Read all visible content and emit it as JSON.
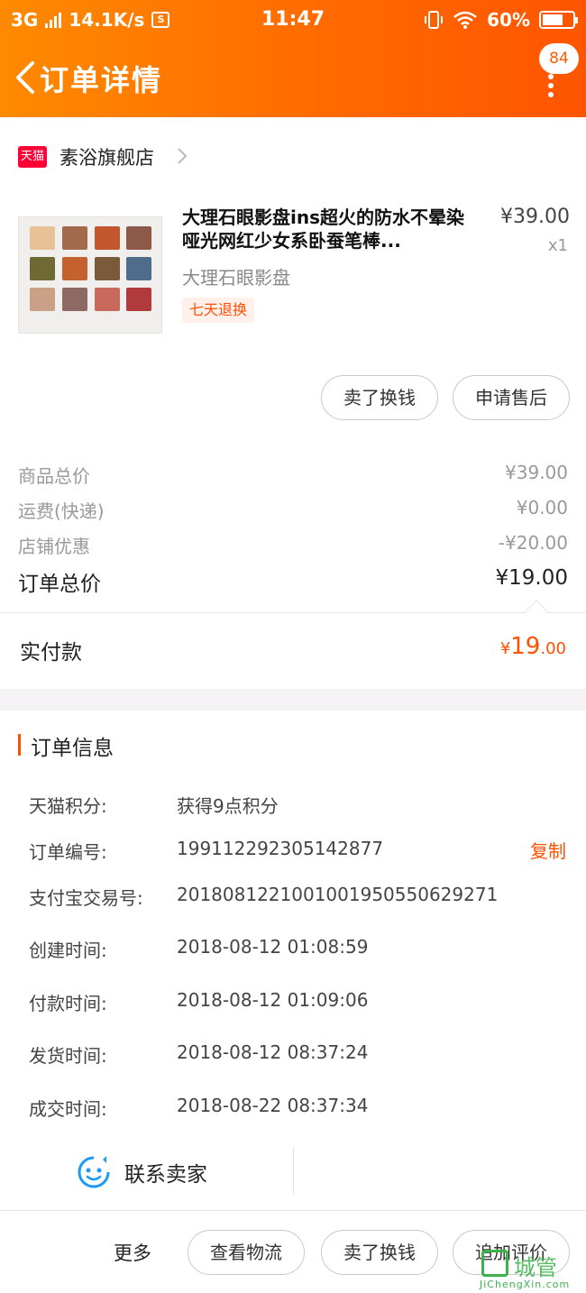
{
  "status_bar": {
    "network": "3G",
    "speed": "14.1K/s",
    "time": "11:47",
    "battery": "60%"
  },
  "header": {
    "title": "订单详情",
    "badge_count": "84"
  },
  "shop": {
    "logo_text": "天猫",
    "name": "素浴旗舰店"
  },
  "product": {
    "title": "大理石眼影盘ins超火的防水不晕染哑光网红少女系卧蚕笔棒...",
    "sku": "大理石眼影盘",
    "price": "¥39.00",
    "quantity": "x1",
    "return_tag": "七天退换",
    "palette_colors": [
      "#e9c196",
      "#a46a4c",
      "#c2572e",
      "#8d5a4a",
      "#6f6a34",
      "#c3622f",
      "#7a5a3a",
      "#4f6d8a",
      "#caa086",
      "#8c6a63",
      "#c8695c",
      "#b03a3c"
    ],
    "buttons": [
      "卖了换钱",
      "申请售后"
    ]
  },
  "summary": {
    "rows": [
      {
        "label": "商品总价",
        "value": "¥39.00"
      },
      {
        "label": "运费(快递)",
        "value": "¥0.00"
      },
      {
        "label": "店铺优惠",
        "value": "-¥20.00"
      }
    ],
    "total_label": "订单总价",
    "total_value": "¥19.00",
    "paid_label": "实付款",
    "paid_currency": "¥",
    "paid_int": "19",
    "paid_dec": ".00"
  },
  "order_info": {
    "section_title": "订单信息",
    "rows": [
      {
        "label": "天猫积分:",
        "value": "获得9点积分"
      },
      {
        "label": "订单编号:",
        "value": "199112292305142877"
      },
      {
        "label": "支付宝交易号:",
        "value": "2018081221001001950550629271"
      },
      {
        "label": "创建时间:",
        "value": "2018-08-12 01:08:59"
      },
      {
        "label": "付款时间:",
        "value": "2018-08-12 01:09:06"
      },
      {
        "label": "发货时间:",
        "value": "2018-08-12 08:37:24"
      },
      {
        "label": "成交时间:",
        "value": "2018-08-22 08:37:34"
      }
    ],
    "copy_label": "复制"
  },
  "contact": {
    "label": "联系卖家"
  },
  "bottom_bar": {
    "more_label": "更多",
    "buttons": [
      "查看物流",
      "卖了换钱",
      "追加评价"
    ]
  },
  "watermark": {
    "text": "城管",
    "url": "JiChengXin.com"
  },
  "colors": {
    "accent": "#ff5000",
    "header_start": "#ff8a00",
    "header_end": "#ff5500",
    "tmall_red": "#ff0036"
  }
}
